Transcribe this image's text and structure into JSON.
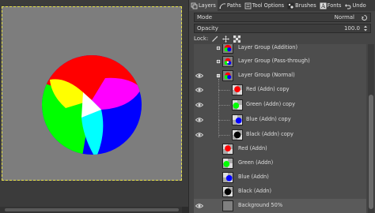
{
  "dock": {
    "tabs": [
      {
        "label": "Layers",
        "icon": "layers-icon"
      },
      {
        "label": "Paths",
        "icon": "paths-icon"
      },
      {
        "label": "Tool Options",
        "icon": "tool-options-icon"
      },
      {
        "label": "Brushes",
        "icon": "brushes-icon"
      },
      {
        "label": "Fonts",
        "icon": "fonts-icon"
      },
      {
        "label": "Undo",
        "icon": "undo-icon"
      }
    ],
    "active_tab": "Layers"
  },
  "layers_panel": {
    "mode_label": "Mode",
    "mode_value": "Normal",
    "opacity_label": "Opacity",
    "opacity_value": "100.0",
    "lock_label": "Lock:",
    "layers": [
      {
        "name": "Layer Group (Addition)",
        "visible": false,
        "expanded": false,
        "group": true
      },
      {
        "name": "Layer Group (Pass-through)",
        "visible": false,
        "expanded": false,
        "group": true
      },
      {
        "name": "Layer Group (Normal)",
        "visible": true,
        "expanded": true,
        "group": true
      },
      {
        "name": "Red (Addn) copy",
        "visible": true,
        "child": true,
        "color": "#ff0000"
      },
      {
        "name": "Green (Addn) copy",
        "visible": true,
        "child": true,
        "color": "#00ff00"
      },
      {
        "name": "Blue (Addn) copy",
        "visible": true,
        "child": true,
        "color": "#0000ff"
      },
      {
        "name": "Black (Addn) copy",
        "visible": true,
        "child": true,
        "color": "#000000"
      },
      {
        "name": "Red (Addn)",
        "visible": false,
        "color": "#ff0000"
      },
      {
        "name": "Green (Addn)",
        "visible": false,
        "color": "#00ff00"
      },
      {
        "name": "Blue (Addn)",
        "visible": false,
        "color": "#0000ff"
      },
      {
        "name": "Black (Addn)",
        "visible": false,
        "color": "#000000"
      },
      {
        "name": "Background 50%",
        "visible": true,
        "color": "#808080"
      }
    ]
  },
  "canvas": {
    "background": "#7d7d7d",
    "colors": {
      "red": "#ff0000",
      "green": "#00ff00",
      "blue": "#0000ff",
      "yellow": "#ffff00",
      "magenta": "#ff00ff",
      "cyan": "#00ffff"
    }
  }
}
